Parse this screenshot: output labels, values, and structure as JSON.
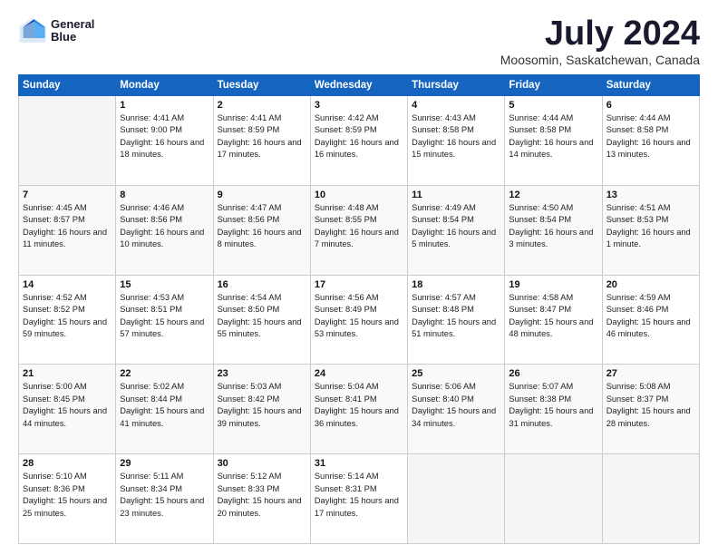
{
  "logo": {
    "line1": "General",
    "line2": "Blue"
  },
  "title": "July 2024",
  "subtitle": "Moosomin, Saskatchewan, Canada",
  "weekdays": [
    "Sunday",
    "Monday",
    "Tuesday",
    "Wednesday",
    "Thursday",
    "Friday",
    "Saturday"
  ],
  "weeks": [
    [
      {
        "day": "",
        "sunrise": "",
        "sunset": "",
        "daylight": ""
      },
      {
        "day": "1",
        "sunrise": "Sunrise: 4:41 AM",
        "sunset": "Sunset: 9:00 PM",
        "daylight": "Daylight: 16 hours and 18 minutes."
      },
      {
        "day": "2",
        "sunrise": "Sunrise: 4:41 AM",
        "sunset": "Sunset: 8:59 PM",
        "daylight": "Daylight: 16 hours and 17 minutes."
      },
      {
        "day": "3",
        "sunrise": "Sunrise: 4:42 AM",
        "sunset": "Sunset: 8:59 PM",
        "daylight": "Daylight: 16 hours and 16 minutes."
      },
      {
        "day": "4",
        "sunrise": "Sunrise: 4:43 AM",
        "sunset": "Sunset: 8:58 PM",
        "daylight": "Daylight: 16 hours and 15 minutes."
      },
      {
        "day": "5",
        "sunrise": "Sunrise: 4:44 AM",
        "sunset": "Sunset: 8:58 PM",
        "daylight": "Daylight: 16 hours and 14 minutes."
      },
      {
        "day": "6",
        "sunrise": "Sunrise: 4:44 AM",
        "sunset": "Sunset: 8:58 PM",
        "daylight": "Daylight: 16 hours and 13 minutes."
      }
    ],
    [
      {
        "day": "7",
        "sunrise": "Sunrise: 4:45 AM",
        "sunset": "Sunset: 8:57 PM",
        "daylight": "Daylight: 16 hours and 11 minutes."
      },
      {
        "day": "8",
        "sunrise": "Sunrise: 4:46 AM",
        "sunset": "Sunset: 8:56 PM",
        "daylight": "Daylight: 16 hours and 10 minutes."
      },
      {
        "day": "9",
        "sunrise": "Sunrise: 4:47 AM",
        "sunset": "Sunset: 8:56 PM",
        "daylight": "Daylight: 16 hours and 8 minutes."
      },
      {
        "day": "10",
        "sunrise": "Sunrise: 4:48 AM",
        "sunset": "Sunset: 8:55 PM",
        "daylight": "Daylight: 16 hours and 7 minutes."
      },
      {
        "day": "11",
        "sunrise": "Sunrise: 4:49 AM",
        "sunset": "Sunset: 8:54 PM",
        "daylight": "Daylight: 16 hours and 5 minutes."
      },
      {
        "day": "12",
        "sunrise": "Sunrise: 4:50 AM",
        "sunset": "Sunset: 8:54 PM",
        "daylight": "Daylight: 16 hours and 3 minutes."
      },
      {
        "day": "13",
        "sunrise": "Sunrise: 4:51 AM",
        "sunset": "Sunset: 8:53 PM",
        "daylight": "Daylight: 16 hours and 1 minute."
      }
    ],
    [
      {
        "day": "14",
        "sunrise": "Sunrise: 4:52 AM",
        "sunset": "Sunset: 8:52 PM",
        "daylight": "Daylight: 15 hours and 59 minutes."
      },
      {
        "day": "15",
        "sunrise": "Sunrise: 4:53 AM",
        "sunset": "Sunset: 8:51 PM",
        "daylight": "Daylight: 15 hours and 57 minutes."
      },
      {
        "day": "16",
        "sunrise": "Sunrise: 4:54 AM",
        "sunset": "Sunset: 8:50 PM",
        "daylight": "Daylight: 15 hours and 55 minutes."
      },
      {
        "day": "17",
        "sunrise": "Sunrise: 4:56 AM",
        "sunset": "Sunset: 8:49 PM",
        "daylight": "Daylight: 15 hours and 53 minutes."
      },
      {
        "day": "18",
        "sunrise": "Sunrise: 4:57 AM",
        "sunset": "Sunset: 8:48 PM",
        "daylight": "Daylight: 15 hours and 51 minutes."
      },
      {
        "day": "19",
        "sunrise": "Sunrise: 4:58 AM",
        "sunset": "Sunset: 8:47 PM",
        "daylight": "Daylight: 15 hours and 48 minutes."
      },
      {
        "day": "20",
        "sunrise": "Sunrise: 4:59 AM",
        "sunset": "Sunset: 8:46 PM",
        "daylight": "Daylight: 15 hours and 46 minutes."
      }
    ],
    [
      {
        "day": "21",
        "sunrise": "Sunrise: 5:00 AM",
        "sunset": "Sunset: 8:45 PM",
        "daylight": "Daylight: 15 hours and 44 minutes."
      },
      {
        "day": "22",
        "sunrise": "Sunrise: 5:02 AM",
        "sunset": "Sunset: 8:44 PM",
        "daylight": "Daylight: 15 hours and 41 minutes."
      },
      {
        "day": "23",
        "sunrise": "Sunrise: 5:03 AM",
        "sunset": "Sunset: 8:42 PM",
        "daylight": "Daylight: 15 hours and 39 minutes."
      },
      {
        "day": "24",
        "sunrise": "Sunrise: 5:04 AM",
        "sunset": "Sunset: 8:41 PM",
        "daylight": "Daylight: 15 hours and 36 minutes."
      },
      {
        "day": "25",
        "sunrise": "Sunrise: 5:06 AM",
        "sunset": "Sunset: 8:40 PM",
        "daylight": "Daylight: 15 hours and 34 minutes."
      },
      {
        "day": "26",
        "sunrise": "Sunrise: 5:07 AM",
        "sunset": "Sunset: 8:38 PM",
        "daylight": "Daylight: 15 hours and 31 minutes."
      },
      {
        "day": "27",
        "sunrise": "Sunrise: 5:08 AM",
        "sunset": "Sunset: 8:37 PM",
        "daylight": "Daylight: 15 hours and 28 minutes."
      }
    ],
    [
      {
        "day": "28",
        "sunrise": "Sunrise: 5:10 AM",
        "sunset": "Sunset: 8:36 PM",
        "daylight": "Daylight: 15 hours and 25 minutes."
      },
      {
        "day": "29",
        "sunrise": "Sunrise: 5:11 AM",
        "sunset": "Sunset: 8:34 PM",
        "daylight": "Daylight: 15 hours and 23 minutes."
      },
      {
        "day": "30",
        "sunrise": "Sunrise: 5:12 AM",
        "sunset": "Sunset: 8:33 PM",
        "daylight": "Daylight: 15 hours and 20 minutes."
      },
      {
        "day": "31",
        "sunrise": "Sunrise: 5:14 AM",
        "sunset": "Sunset: 8:31 PM",
        "daylight": "Daylight: 15 hours and 17 minutes."
      },
      {
        "day": "",
        "sunrise": "",
        "sunset": "",
        "daylight": ""
      },
      {
        "day": "",
        "sunrise": "",
        "sunset": "",
        "daylight": ""
      },
      {
        "day": "",
        "sunrise": "",
        "sunset": "",
        "daylight": ""
      }
    ]
  ]
}
